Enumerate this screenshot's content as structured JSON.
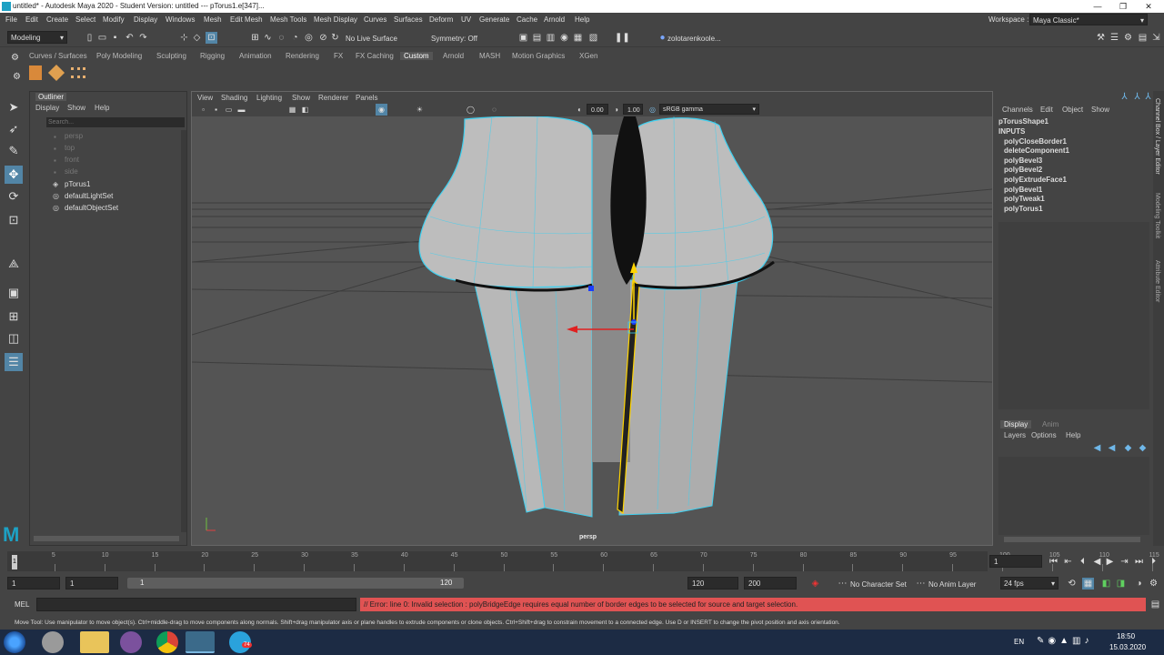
{
  "title": "untitled* - Autodesk Maya 2020 - Student Version: untitled  ---  pTorus1.e[347]...",
  "menu": [
    "File",
    "Edit",
    "Create",
    "Select",
    "Modify",
    "Display",
    "Windows",
    "Mesh",
    "Edit Mesh",
    "Mesh Tools",
    "Mesh Display",
    "Curves",
    "Surfaces",
    "Deform",
    "UV",
    "Generate",
    "Cache",
    "Arnold",
    "Help"
  ],
  "workspace": {
    "label": "Workspace :",
    "value": "Maya Classic*"
  },
  "status": {
    "mode": "Modeling",
    "live_surface": "No Live Surface",
    "symmetry": "Symmetry: Off",
    "user": "zolotarenkoole..."
  },
  "shelf_tabs": [
    "Curves / Surfaces",
    "Poly Modeling",
    "Sculpting",
    "Rigging",
    "Animation",
    "Rendering",
    "FX",
    "FX Caching",
    "Custom",
    "Arnold",
    "MASH",
    "Motion Graphics",
    "XGen"
  ],
  "outliner": {
    "title": "Outliner",
    "menu": [
      "Display",
      "Show",
      "Help"
    ],
    "search": "Search...",
    "items": [
      "persp",
      "top",
      "front",
      "side",
      "pTorus1",
      "defaultLightSet",
      "defaultObjectSet"
    ]
  },
  "viewport": {
    "menu": [
      "View",
      "Shading",
      "Lighting",
      "Show",
      "Renderer",
      "Panels"
    ],
    "exposure": "0.00",
    "gamma": "1.00",
    "colorspace": "sRGB gamma",
    "camera": "persp"
  },
  "channels": {
    "menu": [
      "Channels",
      "Edit",
      "Object",
      "Show"
    ],
    "shape": "pTorusShape1",
    "inputs_label": "INPUTS",
    "inputs": [
      "polyCloseBorder1",
      "deleteComponent1",
      "polyBevel3",
      "polyBevel2",
      "polyExtrudeFace1",
      "polyBevel1",
      "polyTweak1",
      "polyTorus1"
    ]
  },
  "layers": {
    "tabs": [
      "Display",
      "Anim"
    ],
    "menu": [
      "Layers",
      "Options",
      "Help"
    ]
  },
  "sidetabs": [
    "Channel Box / Layer Editor",
    "Modeling Toolkit",
    "Attribute Editor"
  ],
  "timeline": {
    "ticks": [
      "1",
      "5",
      "10",
      "15",
      "20",
      "25",
      "30",
      "35",
      "40",
      "45",
      "50",
      "55",
      "60",
      "65",
      "70",
      "75",
      "80",
      "85",
      "90",
      "95",
      "100",
      "105",
      "110",
      "115",
      "120"
    ],
    "current": "1"
  },
  "range": {
    "start": "1",
    "start2": "1",
    "slider_start": "1",
    "slider_end": "120",
    "end": "120",
    "end2": "200",
    "char_set": "No Character Set",
    "anim_layer": "No Anim Layer",
    "fps": "24 fps"
  },
  "cmd": {
    "label": "MEL",
    "error": "// Error: line 0: Invalid selection : polyBridgeEdge requires equal number of border edges to be selected for source and target selection."
  },
  "help": "Move Tool: Use manipulator to move object(s). Ctrl+middle-drag to move components along normals. Shift+drag manipulator axis or plane handles to extrude components or clone objects. Ctrl+Shift+drag to constrain movement to a connected edge. Use D or INSERT to change the pivot position and axis orientation.",
  "taskbar": {
    "lang": "EN",
    "time": "18:50",
    "date": "15.03.2020",
    "badge": "74"
  }
}
